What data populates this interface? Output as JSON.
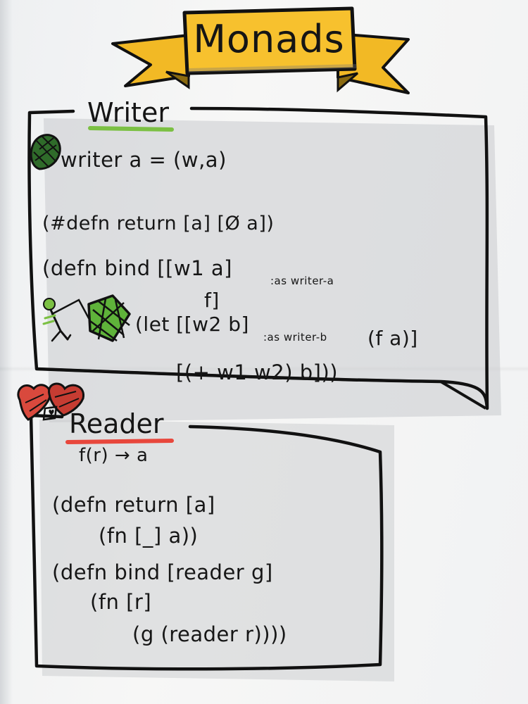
{
  "title": "Monads",
  "colors": {
    "paper": "#f4f4f3",
    "banner": "#f7c12e",
    "ink": "#151515",
    "writer_underline": "#7bc043",
    "reader_underline": "#e8473c",
    "hand_fill": "#6cbf3c",
    "heart_fill": "#d9493d"
  },
  "writer": {
    "heading": "Writer",
    "icon": "leaf-icon",
    "def_line": "writer a = (w,a)",
    "return_line": "(#defn return [a]  [Ø a])",
    "bind_line_1": "(defn bind [[w1 a]",
    "bind_alias_a": ":as writer-a",
    "bind_line_2": "f]",
    "let_line": "(let [[w2 b]",
    "let_alias_b": ":as writer-b",
    "let_call": "(f a)]",
    "result_line": "[(+ w1 w2)  b]))",
    "illustration": "person-pulling-box-icon"
  },
  "reader": {
    "heading": "Reader",
    "icon": "hearts-icon",
    "signature": "f(r) → a",
    "return_line_1": "(defn return [a]",
    "return_line_2": "(fn [_] a))",
    "bind_line_1": "(defn bind [reader g]",
    "bind_line_2": "(fn [r]",
    "bind_line_3": "(g (reader r))))"
  }
}
